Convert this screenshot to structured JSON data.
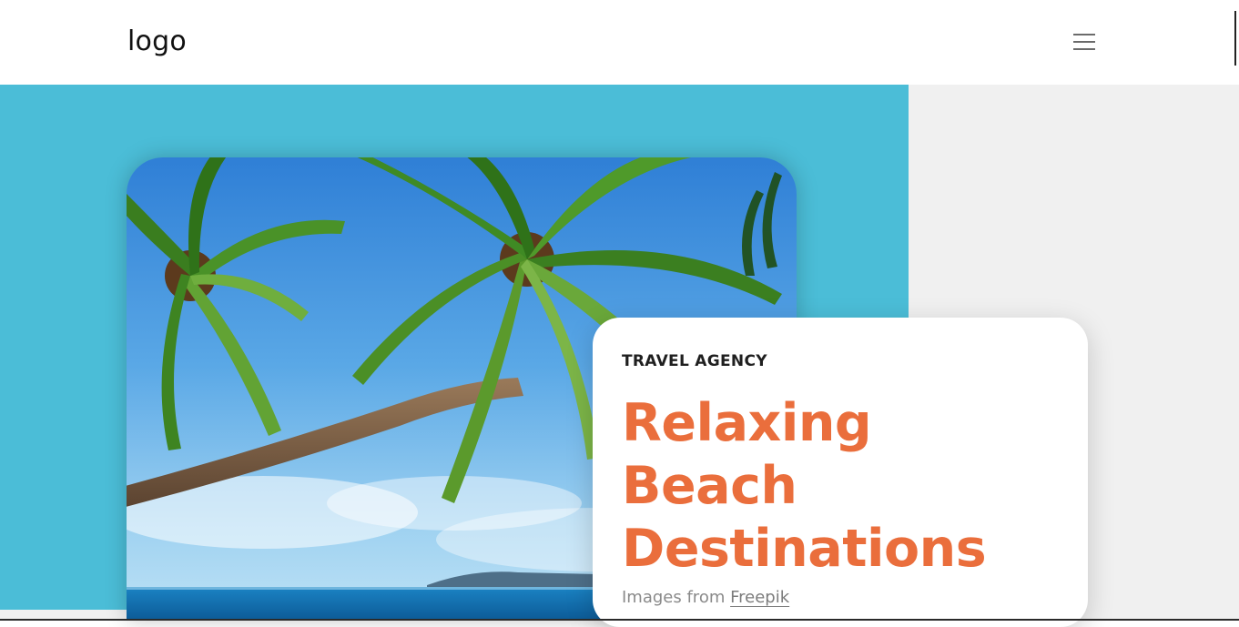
{
  "navbar": {
    "logo": "logo",
    "menu_icon": "hamburger-menu-icon"
  },
  "hero": {
    "image_alt": "Palm trees leaning over a tropical beach",
    "eyebrow": "TRAVEL AGENCY",
    "headline": [
      "Relaxing",
      "Beach",
      "Destinations"
    ],
    "credit_prefix": "Images from ",
    "credit_link": "Freepik"
  },
  "colors": {
    "accent": "#ea6e3c",
    "hero_blue": "#4bbdd7",
    "panel_gray": "#f0f0f0"
  }
}
